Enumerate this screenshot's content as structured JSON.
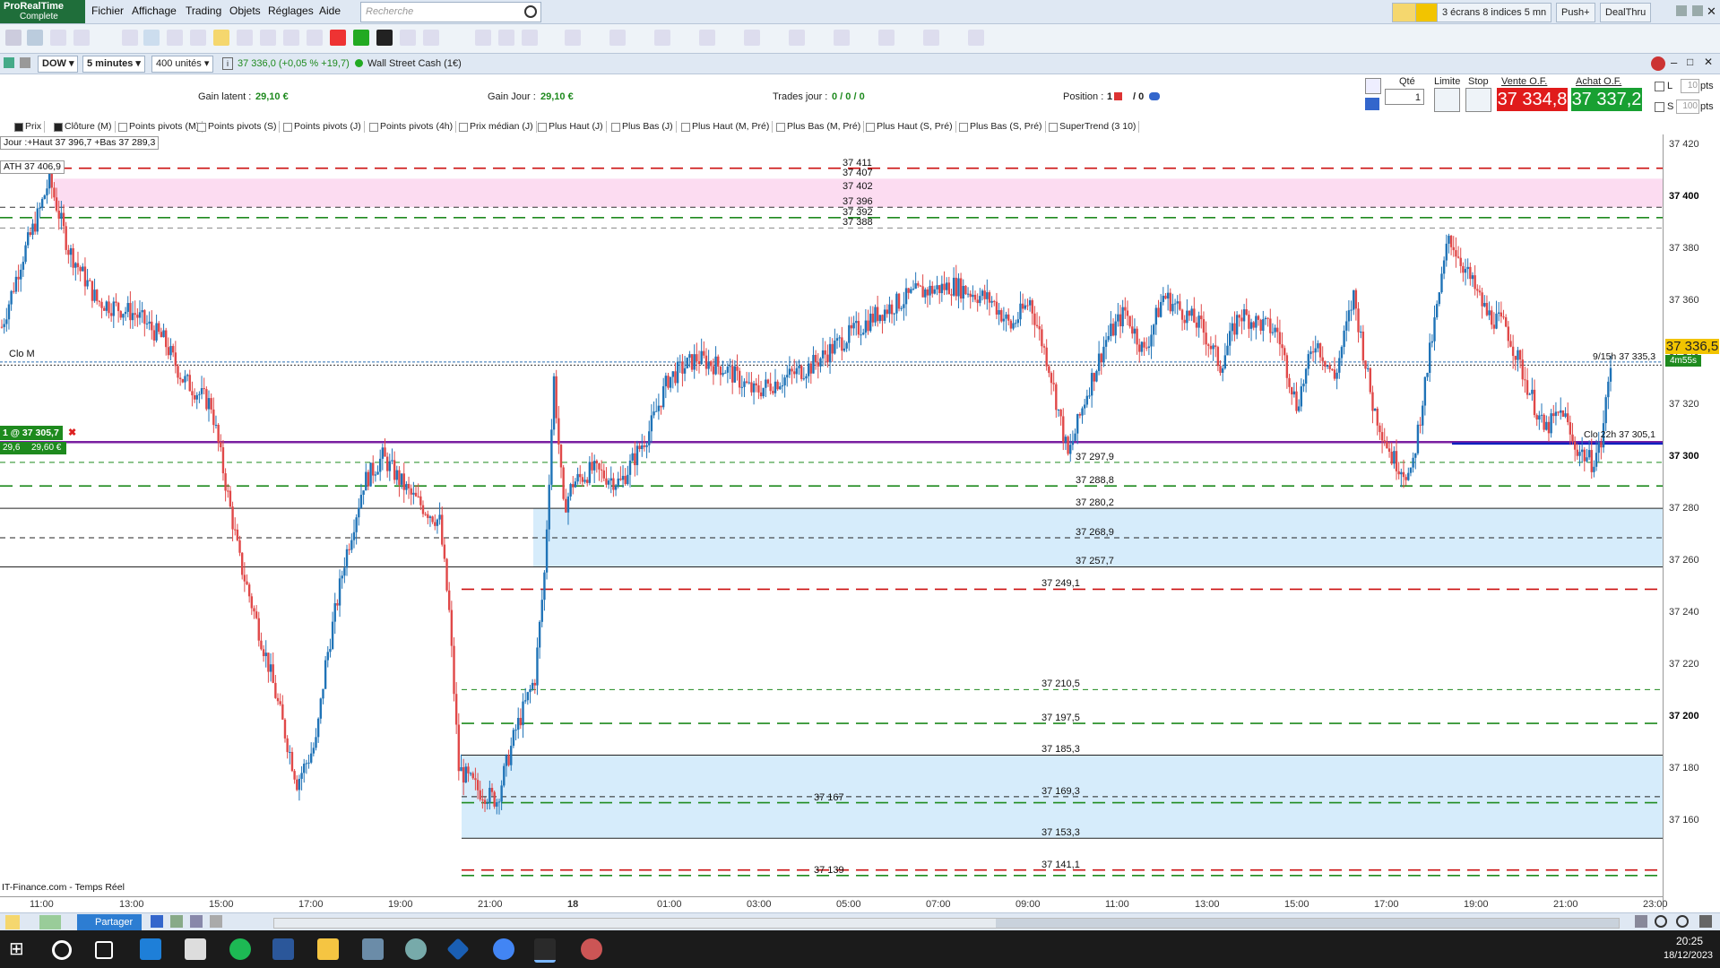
{
  "app": {
    "logo_line1": "ProRealTime",
    "logo_line2": "Complete"
  },
  "menu": [
    "Fichier",
    "Affichage",
    "Trading",
    "Objets",
    "Réglages",
    "Aide"
  ],
  "search": {
    "placeholder": "Recherche"
  },
  "top_right": {
    "screens": "3 écrans 8 indices 5 mn",
    "push": "Push+",
    "dealthru": "DealThru"
  },
  "instrument": {
    "symbol": "DOW",
    "interval": "5 minutes",
    "units": "400 unités",
    "price_info": "37 336,0 (+0,05 % +19,7)",
    "name": "Wall Street Cash (1€)"
  },
  "trading_panel": {
    "gain_latent_label": "Gain latent :",
    "gain_latent_value": "29,10 €",
    "gain_jour_label": "Gain Jour :",
    "gain_jour_value": "29,10 €",
    "trades_label": "Trades jour :",
    "trades_value": "0 / 0 / 0",
    "position_label": "Position :",
    "position_value": "1",
    "position_value2": "/ 0",
    "qte_label": "Qté",
    "qte_value": "1",
    "limite_label": "Limite",
    "stop_label": "Stop",
    "vente_label": "Vente O.F.",
    "vente_value": "37 334,8",
    "achat_label": "Achat O.F.",
    "achat_value": "37 337,2",
    "l_label": "L",
    "l_value": "10",
    "s_label": "S",
    "s_value": "100",
    "pts": "pts"
  },
  "indicators": [
    {
      "label": "Prix",
      "on": true
    },
    {
      "label": "Clôture (M)",
      "on": true
    },
    {
      "label": "Points pivots (M)",
      "on": false
    },
    {
      "label": "Points pivots (S)",
      "on": false
    },
    {
      "label": "Points pivots (J)",
      "on": false
    },
    {
      "label": "Points pivots (4h)",
      "on": false
    },
    {
      "label": "Prix médian (J)",
      "on": false
    },
    {
      "label": "Plus Haut (J)",
      "on": false
    },
    {
      "label": "Plus Bas (J)",
      "on": false
    },
    {
      "label": "Plus Haut (M, Pré)",
      "on": false
    },
    {
      "label": "Plus Bas (M, Pré)",
      "on": false
    },
    {
      "label": "Plus Haut (S, Pré)",
      "on": false
    },
    {
      "label": "Plus Bas (S, Pré)",
      "on": false
    },
    {
      "label": "SuperTrend (3 10)",
      "on": false
    }
  ],
  "chart_labels": {
    "jour": "Jour :+Haut 37 396,7 +Bas 37 289,3",
    "ath": "ATH 37 406,9",
    "clo_m": "Clo M",
    "pos_label": "1 @ 37 305,7",
    "pos_pl1": "29,6",
    "pos_pl2": "29,60 €",
    "clo_9_15": "9/15h 37 335,3",
    "clo_22h": "Clo 22h 37 305,1",
    "source": "IT-Finance.com - Temps Réel",
    "current_price": "37 336,5",
    "countdown": "4m55s"
  },
  "levels": [
    {
      "price": 37411,
      "label": "37 411",
      "color": "#cc1010",
      "style": "long"
    },
    {
      "price": 37407,
      "label": "37 407",
      "color": "#cc1010",
      "style": "none"
    },
    {
      "price": 37402,
      "label": "37 402",
      "color": "#333333",
      "style": "none"
    },
    {
      "price": 37396,
      "label": "37 396",
      "color": "#333333",
      "style": "short"
    },
    {
      "price": 37392,
      "label": "37 392",
      "color": "#1e8a1e",
      "style": "long"
    },
    {
      "price": 37388,
      "label": "37 388",
      "color": "#888888",
      "style": "short"
    },
    {
      "price": 37297.9,
      "label": "37 297,9",
      "color": "#1e8a1e",
      "style": "short"
    },
    {
      "price": 37288.8,
      "label": "37 288,8",
      "color": "#1e8a1e",
      "style": "long"
    },
    {
      "price": 37280.2,
      "label": "37 280,2",
      "color": "#222222",
      "style": "solid"
    },
    {
      "price": 37268.9,
      "label": "37 268,9",
      "color": "#222222",
      "style": "short"
    },
    {
      "price": 37257.7,
      "label": "37 257,7",
      "color": "#222222",
      "style": "solid"
    },
    {
      "price": 37249.1,
      "label": "37 249,1",
      "color": "#cc1010",
      "style": "long"
    },
    {
      "price": 37210.5,
      "label": "37 210,5",
      "color": "#1e8a1e",
      "style": "short"
    },
    {
      "price": 37197.5,
      "label": "37 197,5",
      "color": "#1e8a1e",
      "style": "long"
    },
    {
      "price": 37185.3,
      "label": "37 185,3",
      "color": "#222222",
      "style": "solid"
    },
    {
      "price": 37169.3,
      "label": "37 169,3",
      "color": "#222222",
      "style": "short"
    },
    {
      "price": 37167,
      "label": "37 167",
      "color": "#1e8a1e",
      "style": "long"
    },
    {
      "price": 37153.3,
      "label": "37 153,3",
      "color": "#222222",
      "style": "solid"
    },
    {
      "price": 37141.1,
      "label": "37 141,1",
      "color": "#cc1010",
      "style": "long"
    },
    {
      "price": 37139,
      "label": "37 139",
      "color": "#1e8a1e",
      "style": "long"
    }
  ],
  "chart_data": {
    "type": "candlestick",
    "title": "DOW - 5 minutes - Wall Street Cash (1€)",
    "ylim": [
      37131,
      37424
    ],
    "y_ticks": [
      "37 420",
      "37 400",
      "37 380",
      "37 360",
      "37 340",
      "37 320",
      "37 300",
      "37 280",
      "37 260",
      "37 240",
      "37 220",
      "37 200",
      "37 180",
      "37 160"
    ],
    "y_tick_values": [
      37420,
      37400,
      37380,
      37360,
      37340,
      37320,
      37300,
      37280,
      37260,
      37240,
      37220,
      37200,
      37180,
      37160
    ],
    "bold_ticks": [
      "37 400",
      "37 300",
      "37 200"
    ],
    "x_ticks": [
      "11:00",
      "13:00",
      "15:00",
      "17:00",
      "19:00",
      "21:00",
      "18",
      "01:00",
      "03:00",
      "05:00",
      "07:00",
      "09:00",
      "11:00",
      "13:00",
      "15:00",
      "17:00",
      "19:00",
      "21:00",
      "23:00"
    ],
    "path_points": [
      [
        0,
        37350
      ],
      [
        2,
        37375
      ],
      [
        4,
        37395
      ],
      [
        5,
        37406.9
      ],
      [
        7,
        37380
      ],
      [
        10,
        37360
      ],
      [
        14,
        37355
      ],
      [
        17,
        37345
      ],
      [
        19,
        37330
      ],
      [
        22,
        37320
      ],
      [
        23,
        37300
      ],
      [
        25,
        37260
      ],
      [
        28,
        37220
      ],
      [
        31,
        37175
      ],
      [
        33,
        37190
      ],
      [
        34,
        37220
      ],
      [
        36,
        37260
      ],
      [
        38,
        37290
      ],
      [
        40,
        37300
      ],
      [
        43,
        37285
      ],
      [
        46,
        37275
      ],
      [
        47,
        37240
      ],
      [
        48,
        37180
      ],
      [
        50,
        37172
      ],
      [
        52,
        37168
      ],
      [
        54,
        37195
      ],
      [
        56,
        37215
      ],
      [
        57,
        37255
      ],
      [
        58,
        37330
      ],
      [
        59,
        37280
      ],
      [
        60,
        37290
      ],
      [
        62,
        37295
      ],
      [
        65,
        37290
      ],
      [
        68,
        37310
      ],
      [
        70,
        37330
      ],
      [
        73,
        37338
      ],
      [
        76,
        37334
      ],
      [
        79,
        37325
      ],
      [
        82,
        37330
      ],
      [
        85,
        37335
      ],
      [
        88,
        37344
      ],
      [
        92,
        37355
      ],
      [
        96,
        37363
      ],
      [
        100,
        37366
      ],
      [
        104,
        37360
      ],
      [
        106,
        37350
      ],
      [
        108,
        37360
      ],
      [
        110,
        37335
      ],
      [
        112,
        37300
      ],
      [
        114,
        37325
      ],
      [
        116,
        37345
      ],
      [
        118,
        37356
      ],
      [
        120,
        37340
      ],
      [
        122,
        37362
      ],
      [
        126,
        37350
      ],
      [
        128,
        37335
      ],
      [
        130,
        37355
      ],
      [
        134,
        37348
      ],
      [
        136,
        37320
      ],
      [
        138,
        37345
      ],
      [
        140,
        37330
      ],
      [
        142,
        37362
      ],
      [
        144,
        37320
      ],
      [
        146,
        37300
      ],
      [
        148,
        37292
      ],
      [
        150,
        37340
      ],
      [
        152,
        37385
      ],
      [
        154,
        37370
      ],
      [
        156,
        37355
      ],
      [
        158,
        37350
      ],
      [
        160,
        37330
      ],
      [
        162,
        37310
      ],
      [
        164,
        37318
      ],
      [
        165,
        37305
      ],
      [
        167,
        37298
      ],
      [
        168,
        37305
      ],
      [
        169,
        37336
      ]
    ]
  },
  "bottom": {
    "share": "Partager"
  },
  "taskbar": {
    "time": "20:25",
    "date": "18/12/2023"
  }
}
